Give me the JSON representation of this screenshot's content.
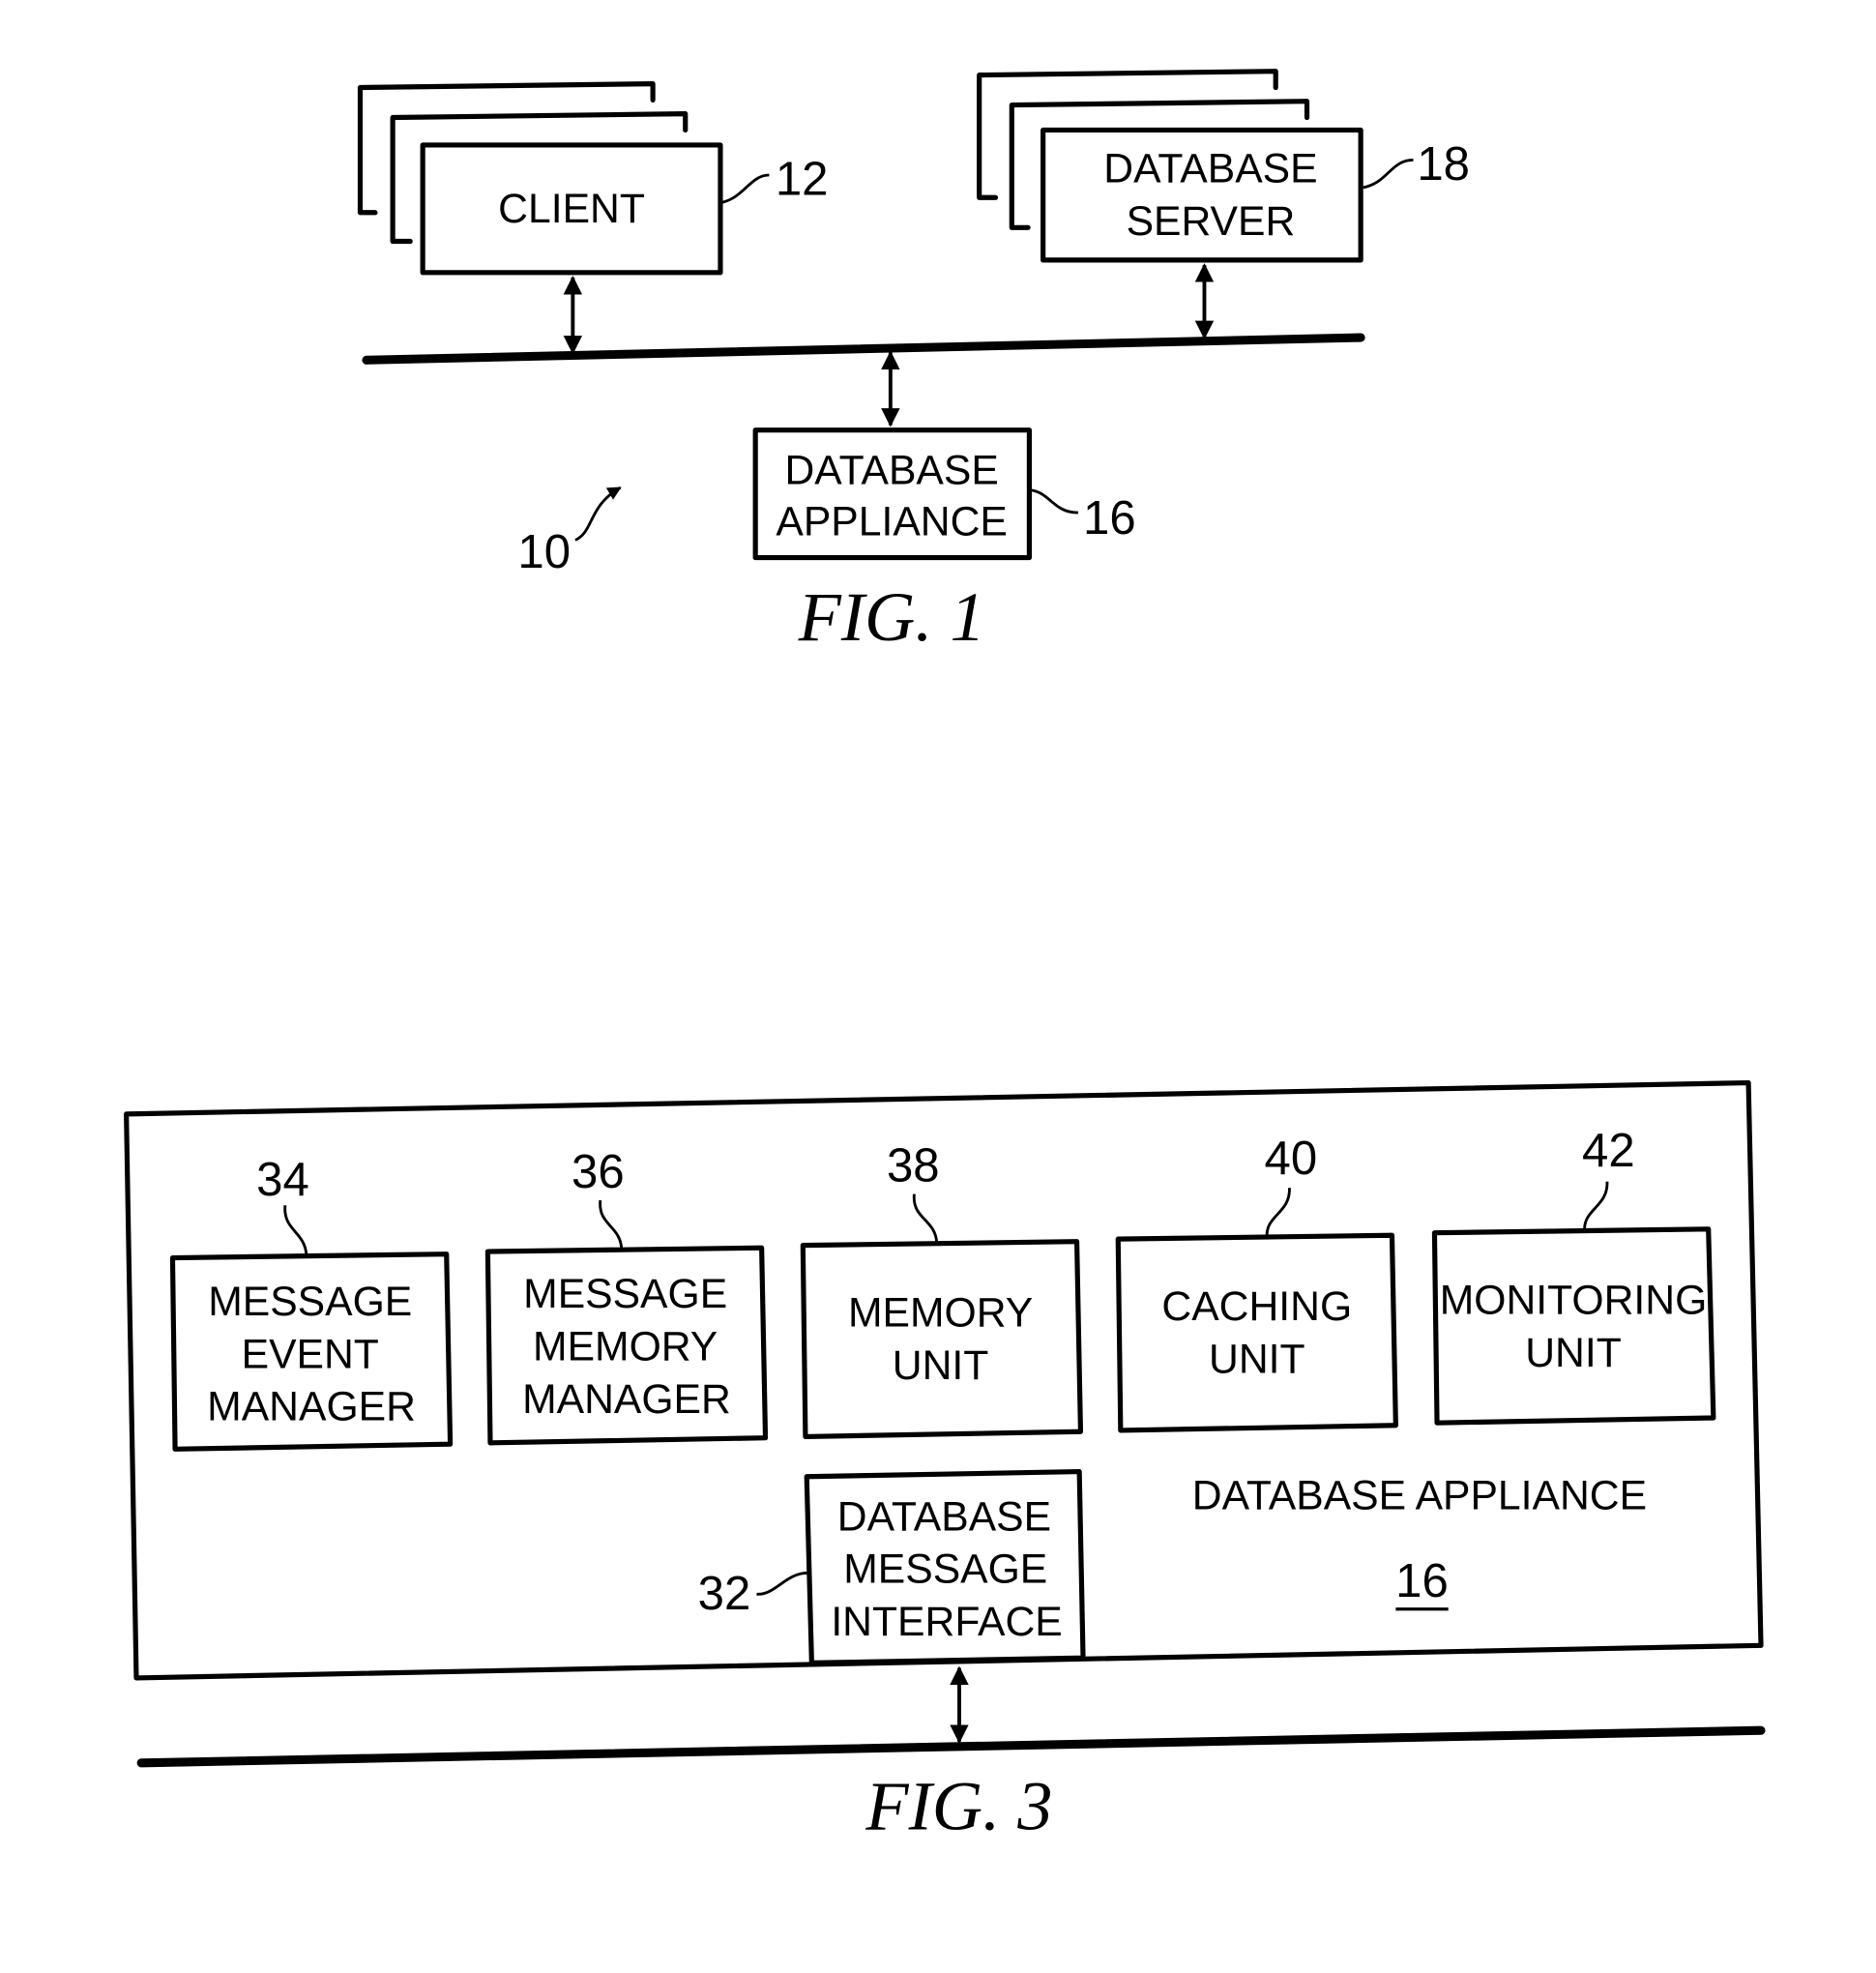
{
  "fig1": {
    "caption": "FIG. 1",
    "system_ref": "10",
    "client": {
      "label": "CLIENT",
      "ref": "12"
    },
    "database_server": {
      "label_line1": "DATABASE",
      "label_line2": "SERVER",
      "ref": "18"
    },
    "database_appliance": {
      "label_line1": "DATABASE",
      "label_line2": "APPLIANCE",
      "ref": "16"
    }
  },
  "fig3": {
    "caption": "FIG. 3",
    "container": {
      "label": "DATABASE APPLIANCE",
      "ref": "16"
    },
    "modules": [
      {
        "ref": "34",
        "lines": [
          "MESSAGE",
          "EVENT",
          "MANAGER"
        ]
      },
      {
        "ref": "36",
        "lines": [
          "MESSAGE",
          "MEMORY",
          "MANAGER"
        ]
      },
      {
        "ref": "38",
        "lines": [
          "MEMORY",
          "UNIT"
        ]
      },
      {
        "ref": "40",
        "lines": [
          "CACHING",
          "UNIT"
        ]
      },
      {
        "ref": "42",
        "lines": [
          "MONITORING",
          "UNIT"
        ]
      }
    ],
    "interface": {
      "ref": "32",
      "lines": [
        "DATABASE",
        "MESSAGE",
        "INTERFACE"
      ]
    }
  }
}
